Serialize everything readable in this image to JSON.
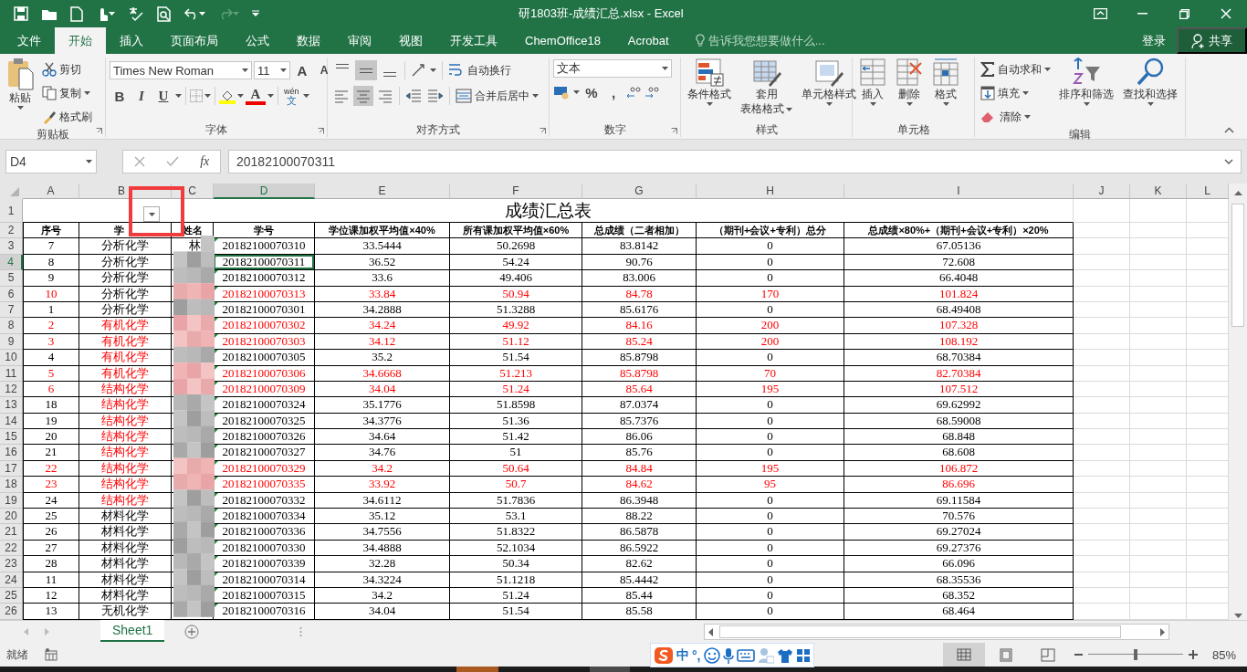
{
  "quick_access": {
    "redo": {
      "disabled": true
    }
  },
  "title_bar": {
    "title": "研1803班-成绩汇总.xlsx - Excel"
  },
  "ribbon_tabs": [
    {
      "label": "文件",
      "selected": false
    },
    {
      "label": "开始",
      "selected": true
    },
    {
      "label": "插入",
      "selected": false
    },
    {
      "label": "页面布局",
      "selected": false
    },
    {
      "label": "公式",
      "selected": false
    },
    {
      "label": "数据",
      "selected": false
    },
    {
      "label": "审阅",
      "selected": false
    },
    {
      "label": "视图",
      "selected": false
    },
    {
      "label": "开发工具",
      "selected": false
    },
    {
      "label": "ChemOffice18",
      "selected": false
    },
    {
      "label": "Acrobat",
      "selected": false
    }
  ],
  "tell_me": {
    "placeholder": "告诉我您想要做什么..."
  },
  "account": {
    "sign_in": "登录",
    "share": "共享"
  },
  "ribbon": {
    "clipboard": {
      "label": "剪贴板",
      "paste": "粘贴",
      "cut": "剪切",
      "copy": "复制",
      "painter": "格式刷"
    },
    "font": {
      "label": "字体",
      "font_name": "Times New Roman",
      "font_size": "11",
      "grow": "A",
      "shrink": "A",
      "bold": "B",
      "italic": "I",
      "underline": "U",
      "font_color": "A",
      "phonetic": "wén",
      "phonetic_char": "文"
    },
    "alignment": {
      "label": "对齐方式",
      "vertical": [
        {
          "selected": false
        },
        {
          "selected": true
        },
        {
          "selected": false
        }
      ],
      "horizontal": [
        {
          "selected": false
        },
        {
          "selected": true
        },
        {
          "selected": false
        }
      ],
      "wrap": "自动换行",
      "merge": "合并后居中"
    },
    "number": {
      "label": "数字",
      "format": "文本",
      "percent": "%",
      "comma": ","
    },
    "styles": {
      "label": "样式",
      "conditional": "条件格式",
      "table": [
        "套用",
        "表格格式"
      ],
      "cell_styles": "单元格样式"
    },
    "cells": {
      "label": "单元格",
      "insert": "插入",
      "delete": "删除",
      "format": "格式"
    },
    "editing": {
      "label": "编辑",
      "autosum": "自动求和",
      "fill": "填充",
      "clear": "清除",
      "sort": "排序和筛选",
      "find": "查找和选择"
    }
  },
  "formula_bar": {
    "name_box": "D4",
    "function_label": "fx",
    "value": "20182100070311"
  },
  "sheet": {
    "columns": [
      {
        "label": "A",
        "selected": false
      },
      {
        "label": "B",
        "selected": false
      },
      {
        "label": "C",
        "selected": false
      },
      {
        "label": "D",
        "selected": true
      },
      {
        "label": "E",
        "selected": false
      },
      {
        "label": "F",
        "selected": false
      },
      {
        "label": "G",
        "selected": false
      },
      {
        "label": "H",
        "selected": false
      },
      {
        "label": "I",
        "selected": false
      },
      {
        "label": "J",
        "selected": false
      },
      {
        "label": "K",
        "selected": false
      },
      {
        "label": "L",
        "selected": false
      }
    ],
    "title_row": "1",
    "title": "成绩汇总表",
    "header_row": "2",
    "headers": [
      "序号",
      "学",
      "姓名",
      "学号",
      "学位课加权平均值×40%",
      "所有课加权平均值×60%",
      "总成绩（二者相加）",
      "（期刊+会议+专利）总分",
      "总成绩×80%+（期刊+会议+专利）×20%"
    ],
    "rows": [
      {
        "number": "3",
        "selected": false,
        "flagged": false,
        "subject_flagged": false,
        "cells": [
          "7",
          "分析化学",
          "林",
          "20182100070310",
          "33.5444",
          "50.2698",
          "83.8142",
          "0",
          "67.05136"
        ]
      },
      {
        "number": "4",
        "selected": true,
        "flagged": false,
        "subject_flagged": false,
        "cells": [
          "8",
          "分析化学",
          "",
          "20182100070311",
          "36.52",
          "54.24",
          "90.76",
          "0",
          "72.608"
        ]
      },
      {
        "number": "5",
        "selected": false,
        "flagged": false,
        "subject_flagged": false,
        "cells": [
          "9",
          "分析化学",
          "",
          "20182100070312",
          "33.6",
          "49.406",
          "83.006",
          "0",
          "66.4048"
        ]
      },
      {
        "number": "6",
        "selected": false,
        "flagged": true,
        "subject_flagged": false,
        "cells": [
          "10",
          "分析化学",
          "",
          "20182100070313",
          "33.84",
          "50.94",
          "84.78",
          "170",
          "101.824"
        ]
      },
      {
        "number": "7",
        "selected": false,
        "flagged": false,
        "subject_flagged": false,
        "cells": [
          "1",
          "分析化学",
          "",
          "20182100070301",
          "34.2888",
          "51.3288",
          "85.6176",
          "0",
          "68.49408"
        ]
      },
      {
        "number": "8",
        "selected": false,
        "flagged": true,
        "subject_flagged": true,
        "cells": [
          "2",
          "有机化学",
          "",
          "20182100070302",
          "34.24",
          "49.92",
          "84.16",
          "200",
          "107.328"
        ]
      },
      {
        "number": "9",
        "selected": false,
        "flagged": true,
        "subject_flagged": true,
        "cells": [
          "3",
          "有机化学",
          "",
          "20182100070303",
          "34.12",
          "51.12",
          "85.24",
          "200",
          "108.192"
        ]
      },
      {
        "number": "10",
        "selected": false,
        "flagged": false,
        "subject_flagged": true,
        "cells": [
          "4",
          "有机化学",
          "",
          "20182100070305",
          "35.2",
          "51.54",
          "85.8798",
          "0",
          "68.70384"
        ]
      },
      {
        "number": "11",
        "selected": false,
        "flagged": true,
        "subject_flagged": true,
        "cells": [
          "5",
          "有机化学",
          "",
          "20182100070306",
          "34.6668",
          "51.213",
          "85.8798",
          "70",
          "82.70384"
        ]
      },
      {
        "number": "12",
        "selected": false,
        "flagged": true,
        "subject_flagged": true,
        "cells": [
          "6",
          "结构化学",
          "",
          "20182100070309",
          "34.04",
          "51.24",
          "85.64",
          "195",
          "107.512"
        ]
      },
      {
        "number": "13",
        "selected": false,
        "flagged": false,
        "subject_flagged": true,
        "cells": [
          "18",
          "结构化学",
          "",
          "20182100070324",
          "35.1776",
          "51.8598",
          "87.0374",
          "0",
          "69.62992"
        ]
      },
      {
        "number": "14",
        "selected": false,
        "flagged": false,
        "subject_flagged": true,
        "cells": [
          "19",
          "结构化学",
          "",
          "20182100070325",
          "34.3776",
          "51.36",
          "85.7376",
          "0",
          "68.59008"
        ]
      },
      {
        "number": "15",
        "selected": false,
        "flagged": false,
        "subject_flagged": true,
        "cells": [
          "20",
          "结构化学",
          "",
          "20182100070326",
          "34.64",
          "51.42",
          "86.06",
          "0",
          "68.848"
        ]
      },
      {
        "number": "16",
        "selected": false,
        "flagged": false,
        "subject_flagged": true,
        "cells": [
          "21",
          "结构化学",
          "",
          "20182100070327",
          "34.76",
          "51",
          "85.76",
          "0",
          "68.608"
        ]
      },
      {
        "number": "17",
        "selected": false,
        "flagged": true,
        "subject_flagged": true,
        "cells": [
          "22",
          "结构化学",
          "",
          "20182100070329",
          "34.2",
          "50.64",
          "84.84",
          "195",
          "106.872"
        ]
      },
      {
        "number": "18",
        "selected": false,
        "flagged": true,
        "subject_flagged": true,
        "cells": [
          "23",
          "结构化学",
          "",
          "20182100070335",
          "33.92",
          "50.7",
          "84.62",
          "95",
          "86.696"
        ]
      },
      {
        "number": "19",
        "selected": false,
        "flagged": false,
        "subject_flagged": true,
        "cells": [
          "24",
          "结构化学",
          "",
          "20182100070332",
          "34.6112",
          "51.7836",
          "86.3948",
          "0",
          "69.11584"
        ]
      },
      {
        "number": "20",
        "selected": false,
        "flagged": false,
        "subject_flagged": false,
        "cells": [
          "25",
          "材料化学",
          "",
          "20182100070334",
          "35.12",
          "53.1",
          "88.22",
          "0",
          "70.576"
        ]
      },
      {
        "number": "21",
        "selected": false,
        "flagged": false,
        "subject_flagged": false,
        "cells": [
          "26",
          "材料化学",
          "",
          "20182100070336",
          "34.7556",
          "51.8322",
          "86.5878",
          "0",
          "69.27024"
        ]
      },
      {
        "number": "22",
        "selected": false,
        "flagged": false,
        "subject_flagged": false,
        "cells": [
          "27",
          "材料化学",
          "",
          "20182100070330",
          "34.4888",
          "52.1034",
          "86.5922",
          "0",
          "69.27376"
        ]
      },
      {
        "number": "23",
        "selected": false,
        "flagged": false,
        "subject_flagged": false,
        "cells": [
          "28",
          "材料化学",
          "",
          "20182100070339",
          "32.28",
          "50.34",
          "82.62",
          "0",
          "66.096"
        ]
      },
      {
        "number": "24",
        "selected": false,
        "flagged": false,
        "subject_flagged": false,
        "cells": [
          "11",
          "材料化学",
          "",
          "20182100070314",
          "34.3224",
          "51.1218",
          "85.4442",
          "0",
          "68.35536"
        ]
      },
      {
        "number": "25",
        "selected": false,
        "flagged": false,
        "subject_flagged": false,
        "cells": [
          "12",
          "材料化学",
          "",
          "20182100070315",
          "34.2",
          "51.24",
          "85.44",
          "0",
          "68.352"
        ]
      },
      {
        "number": "26",
        "selected": false,
        "flagged": false,
        "subject_flagged": false,
        "cells": [
          "13",
          "无机化学",
          "",
          "20182100070316",
          "34.04",
          "51.54",
          "85.58",
          "0",
          "68.464"
        ]
      }
    ]
  },
  "sheet_tabs": [
    {
      "label": "Sheet1",
      "selected": true
    }
  ],
  "status_bar": {
    "ready": "就绪",
    "view_modes": [
      {
        "selected": true
      },
      {
        "selected": false
      },
      {
        "selected": false
      }
    ],
    "zoom_slider": {
      "level": 0.5
    },
    "zoom": "85%"
  },
  "ime": {
    "mode": "中",
    "punctuation": "°,"
  }
}
